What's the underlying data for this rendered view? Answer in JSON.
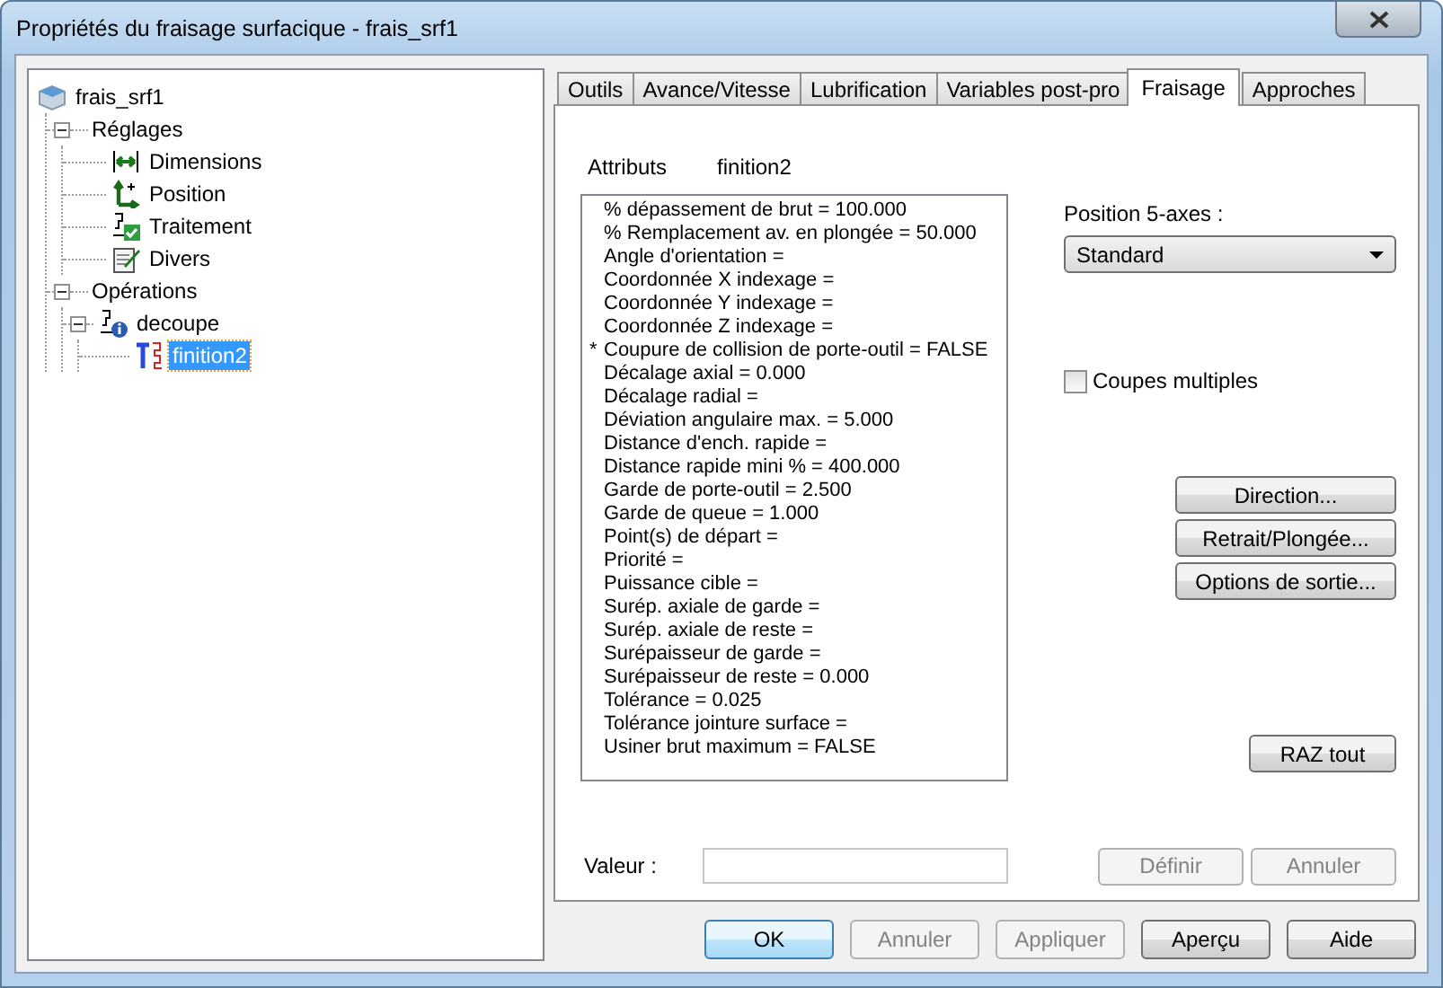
{
  "window": {
    "title": "Propriétés du fraisage surfacique - frais_srf1"
  },
  "tree": {
    "label": "frais_srf1",
    "kind": "part",
    "selected": false,
    "children": [
      {
        "label": "Réglages",
        "kind": "group",
        "selected": false,
        "expanded": true,
        "children": [
          {
            "label": "Dimensions",
            "kind": "dimensions",
            "selected": false
          },
          {
            "label": "Position",
            "kind": "position",
            "selected": false
          },
          {
            "label": "Traitement",
            "kind": "process",
            "selected": false
          },
          {
            "label": "Divers",
            "kind": "notes",
            "selected": false
          }
        ]
      },
      {
        "label": "Opérations",
        "kind": "group",
        "selected": false,
        "expanded": true,
        "children": [
          {
            "label": "decoupe",
            "kind": "operation",
            "selected": false,
            "expanded": true,
            "children": [
              {
                "label": "finition2",
                "kind": "toolpath",
                "selected": true
              }
            ]
          }
        ]
      }
    ]
  },
  "tabs": [
    {
      "label": "Outils",
      "selected": false
    },
    {
      "label": "Avance/Vitesse",
      "selected": false
    },
    {
      "label": "Lubrification",
      "selected": false
    },
    {
      "label": "Variables post-pro",
      "selected": false
    },
    {
      "label": "Fraisage",
      "selected": true
    },
    {
      "label": "Approches",
      "selected": false
    }
  ],
  "attributes": {
    "label": "Attributs",
    "target": "finition2",
    "items": [
      {
        "text": "% dépassement de brut = 100.000"
      },
      {
        "text": "% Remplacement av. en plongée = 50.000"
      },
      {
        "text": "Angle d'orientation ="
      },
      {
        "text": "Coordonnée X indexage ="
      },
      {
        "text": "Coordonnée Y indexage ="
      },
      {
        "text": "Coordonnée Z indexage ="
      },
      {
        "marker": "*",
        "text": "Coupure de collision de porte-outil = FALSE"
      },
      {
        "text": "Décalage axial = 0.000"
      },
      {
        "text": "Décalage radial ="
      },
      {
        "text": "Déviation angulaire max. = 5.000"
      },
      {
        "text": "Distance d'ench. rapide ="
      },
      {
        "text": "Distance rapide mini % = 400.000"
      },
      {
        "text": "Garde de porte-outil = 2.500"
      },
      {
        "text": "Garde de queue = 1.000"
      },
      {
        "text": "Point(s) de départ ="
      },
      {
        "text": "Priorité ="
      },
      {
        "text": "Puissance cible ="
      },
      {
        "text": "Surép. axiale de garde ="
      },
      {
        "text": "Surép. axiale de reste ="
      },
      {
        "text": "Surépaisseur de garde ="
      },
      {
        "text": "Surépaisseur de reste = 0.000"
      },
      {
        "text": "Tolérance = 0.025"
      },
      {
        "text": "Tolérance jointure surface ="
      },
      {
        "text": "Usiner brut maximum = FALSE"
      }
    ]
  },
  "position_5_axes": {
    "label": "Position 5-axes :",
    "value": "Standard"
  },
  "multiple_cuts": {
    "label": "Coupes multiples",
    "checked": false
  },
  "side_buttons": [
    {
      "label": "Direction...",
      "disabled": false
    },
    {
      "label": "Retrait/Plongée...",
      "disabled": false
    },
    {
      "label": "Options de sortie...",
      "disabled": false
    }
  ],
  "reset_button": {
    "label": "RAZ tout",
    "disabled": false
  },
  "value_field": {
    "label": "Valeur :"
  },
  "value_buttons": [
    {
      "label": "Définir",
      "disabled": true
    },
    {
      "label": "Annuler",
      "disabled": true
    }
  ],
  "footer_buttons": [
    {
      "label": "OK",
      "disabled": false,
      "focused": true
    },
    {
      "label": "Annuler",
      "disabled": true,
      "focused": false
    },
    {
      "label": "Appliquer",
      "disabled": true,
      "focused": false
    },
    {
      "label": "Aperçu",
      "disabled": false,
      "focused": false
    },
    {
      "label": "Aide",
      "disabled": false,
      "focused": false
    }
  ]
}
